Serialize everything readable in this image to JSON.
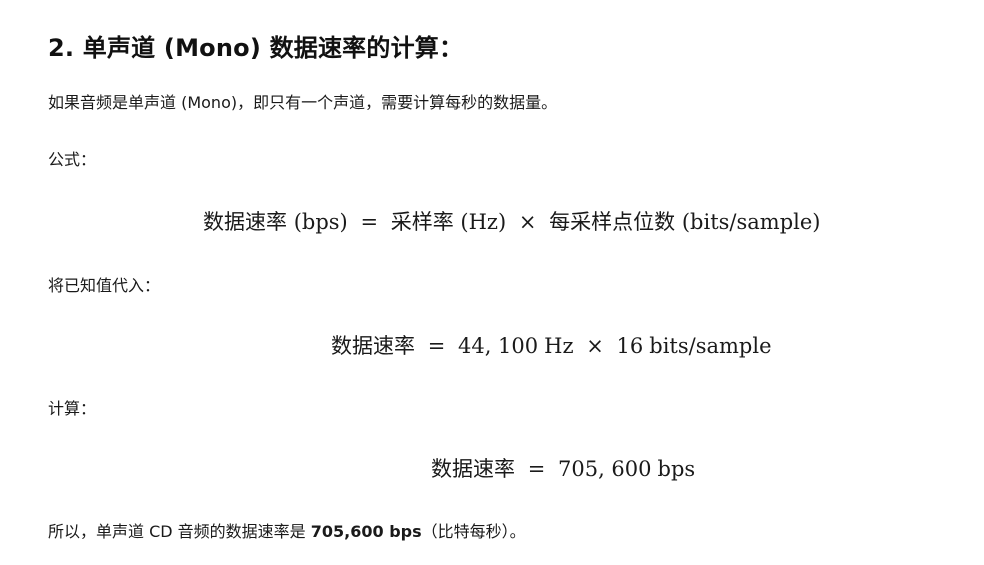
{
  "section": {
    "heading": "2. 单声道 (Mono) 数据速率的计算："
  },
  "paragraphs": {
    "intro": "如果音频是单声道 (Mono)，即只有一个声道，需要计算每秒的数据量。",
    "formula_label": "公式：",
    "substitute_label": "将已知值代入：",
    "compute_label": "计算：",
    "conclusion_prefix": "所以，单声道 CD 音频的数据速率是 ",
    "conclusion_value": "705,600 bps",
    "conclusion_suffix": "（比特每秒）。"
  },
  "formulas": {
    "general": {
      "lhs": "数据速率",
      "lhs_unit": "(bps)",
      "eq": "=",
      "factor1": "采样率",
      "factor1_unit": "(Hz)",
      "times": "×",
      "factor2": "每采样点位数",
      "factor2_unit": "(bits/sample)"
    },
    "substituted": {
      "lhs": "数据速率",
      "eq": "=",
      "value1": "44, 100",
      "unit1": "Hz",
      "times": "×",
      "value2": "16",
      "unit2": "bits/sample"
    },
    "result": {
      "lhs": "数据速率",
      "eq": "=",
      "value": "705, 600",
      "unit": "bps"
    }
  }
}
